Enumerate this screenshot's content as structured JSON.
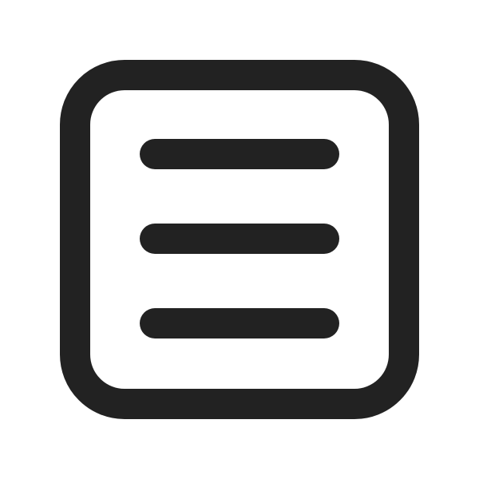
{
  "icon": {
    "name": "menu-square-icon",
    "stroke_color": "#222222",
    "background_color": "#ffffff"
  }
}
